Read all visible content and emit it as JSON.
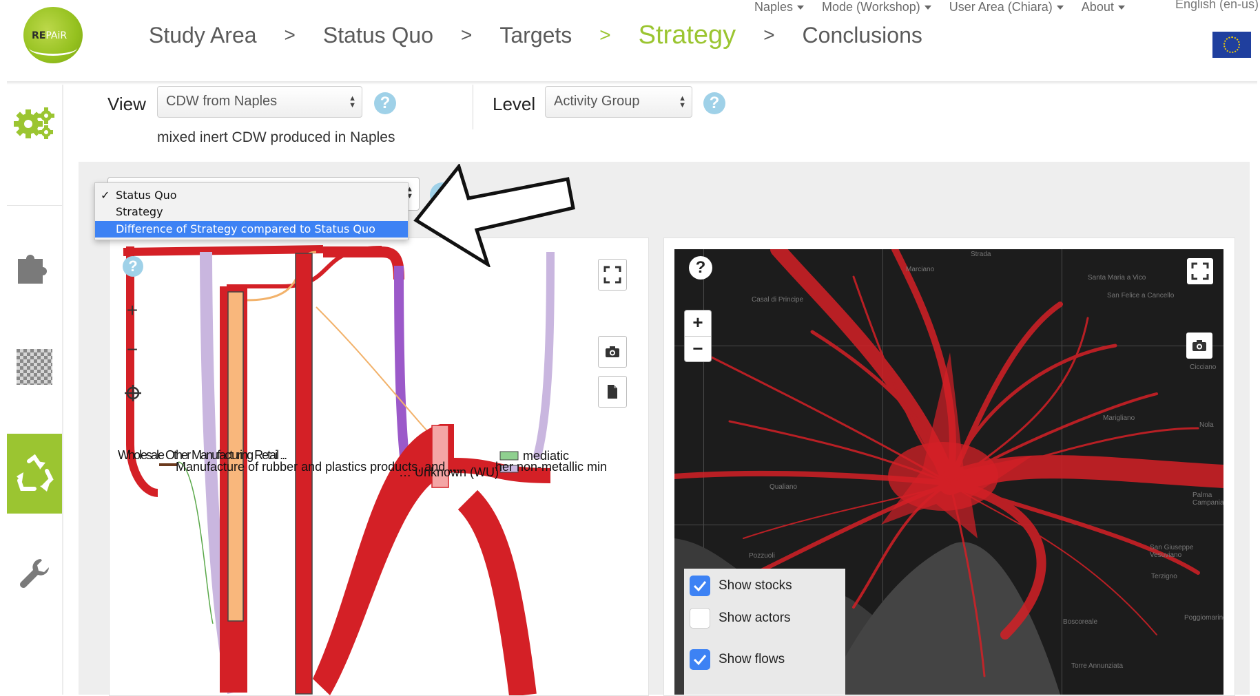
{
  "header": {
    "logo_text_a": "RE",
    "logo_text_b": "PAiR",
    "crumbs": [
      "Study Area",
      "Status Quo",
      "Targets",
      "Strategy",
      "Conclusions"
    ],
    "separator": ">",
    "topnav": {
      "city": "Naples",
      "mode": "Mode (Workshop)",
      "user": "User Area (Chiara)",
      "about": "About",
      "language": "English (en-us)"
    }
  },
  "sidebar": {
    "items": [
      {
        "icon": "gears-icon"
      },
      {
        "icon": "puzzle-icon"
      },
      {
        "icon": "checkerboard-icon"
      },
      {
        "icon": "recycle-icon",
        "active": true
      },
      {
        "icon": "wrench-icon"
      }
    ]
  },
  "filters": {
    "view_label": "View",
    "view_value": "CDW from Naples",
    "level_label": "Level",
    "level_value": "Activity Group",
    "description": "mixed inert CDW produced in Naples"
  },
  "comparison_dropdown": {
    "options": [
      "Status Quo",
      "Strategy",
      "Difference of Strategy compared to Status Quo"
    ],
    "checked": "Status Quo",
    "highlighted": "Difference of Strategy compared to Status Quo",
    "checkmark": "✓"
  },
  "sankey": {
    "help": "?",
    "zoom_in": "+",
    "zoom_out": "−",
    "labels": {
      "row1": "Wholesale Other Manufacturing Retail ... ",
      "row2": "Manufacture of rubber and plastics products, and ...",
      "middle": "… Unknown (WU)",
      "right_row1": "mediatic",
      "right_row2": "her non-metallic min"
    }
  },
  "map": {
    "help": "?",
    "zoom_in": "+",
    "zoom_out": "−",
    "layers": [
      {
        "label": "Show stocks",
        "checked": true
      },
      {
        "label": "Show actors",
        "checked": false
      },
      {
        "label": "Show flows",
        "checked": true
      }
    ],
    "place_labels": [
      "Strada",
      "Marciano",
      "Santa Maria a Vico",
      "San Felice a Cancello",
      "Casal di Principe",
      "Cicciano",
      "Nola",
      "Marigliano",
      "Qualiano",
      "Pozzuoli",
      "Palma Campania",
      "San Giuseppe Vesuviano",
      "Terzigno",
      "Boscoreale",
      "Torre Annunziata",
      "Poggiomarino"
    ]
  },
  "colors": {
    "accent": "#9bc531",
    "flow_red": "#d42026",
    "select_blue": "#3d82f4",
    "help_blue": "#9fd1e8"
  }
}
